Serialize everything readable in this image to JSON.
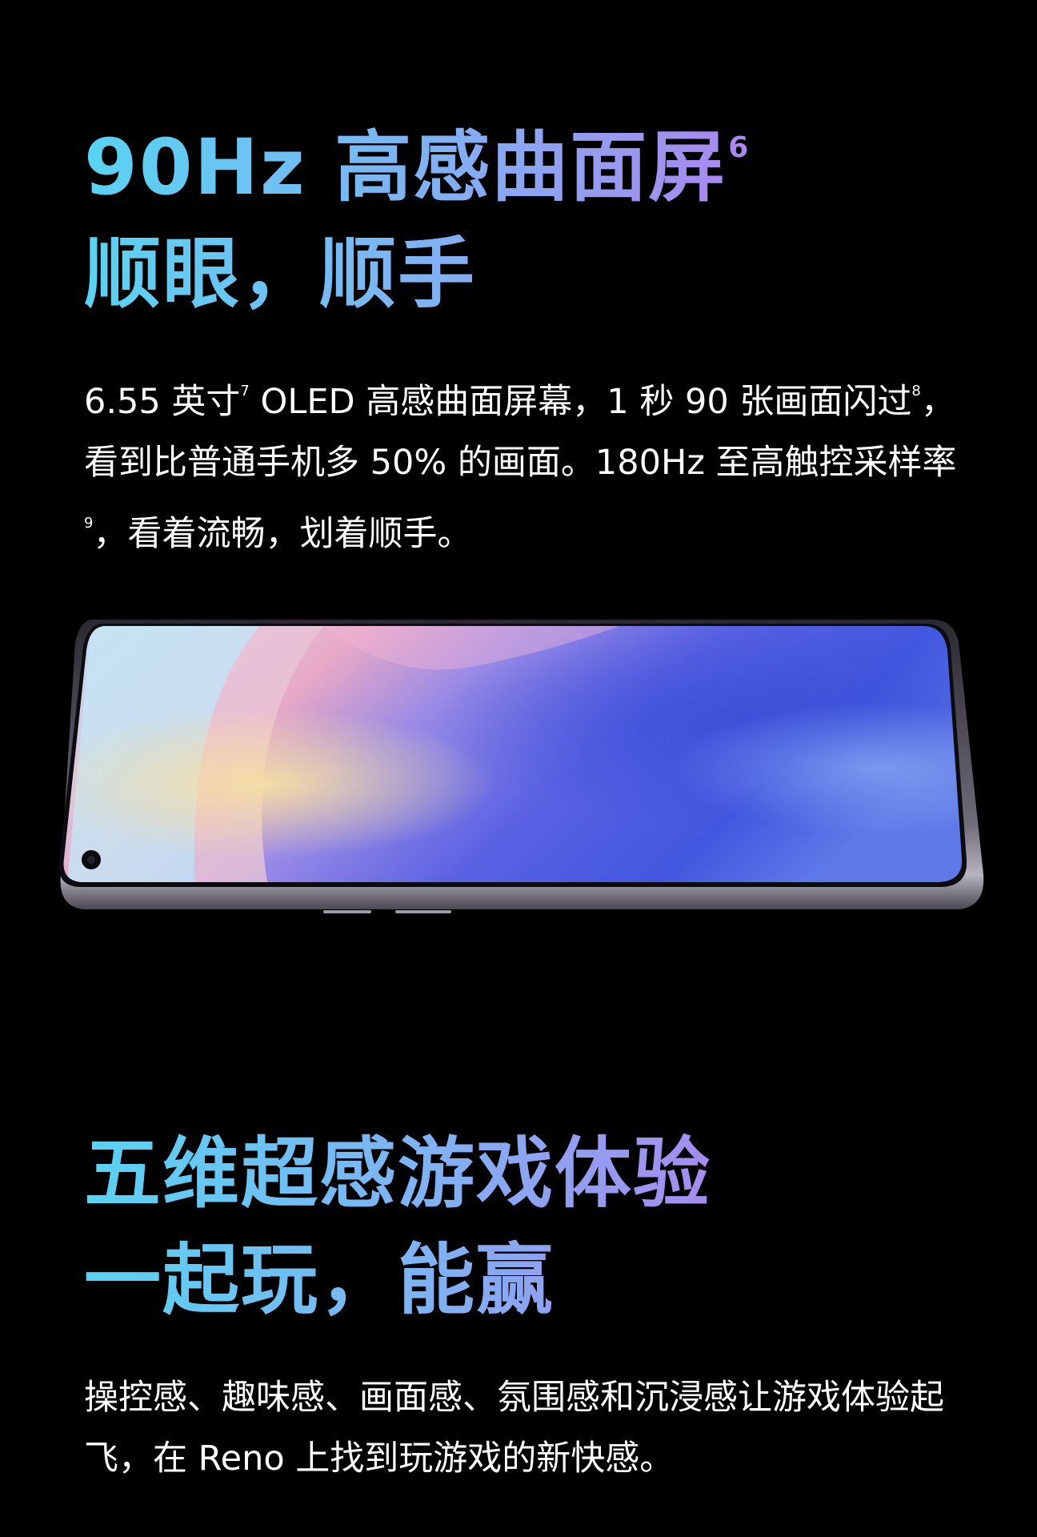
{
  "section1": {
    "title_line1": "90Hz 高感曲面屏",
    "title_line1_sup": "6",
    "title_line2": "顺眼，顺手",
    "body": [
      {
        "text": "6.55 英寸",
        "sup": "7"
      },
      {
        "text": " OLED 高感曲面屏幕，1 秒 90 张画面闪过",
        "sup": "8"
      },
      {
        "text": "，看到比普通手机多 50% 的画面。180Hz 至高触控采样率",
        "sup": "9"
      },
      {
        "text": "，看着流畅，划着顺手。",
        "sup": ""
      }
    ]
  },
  "phone_image": {
    "icon": "phone-curved-screen-illustration",
    "colors": {
      "screen_left": "#bfe3f4",
      "screen_pink": "#e7a3c8",
      "screen_yellow": "#f4d9a0",
      "screen_blue": "#4257e0",
      "frame": "#8f8a99"
    }
  },
  "section2": {
    "title_line1": "五维超感游戏体验",
    "title_line2": "一起玩，能赢",
    "body": "操控感、趣味感、画面感、氛围感和沉浸感让游戏体验起飞，在 Reno 上找到玩游戏的新快感。"
  },
  "colors": {
    "background": "#000000",
    "gradient_start": "#59d3f2",
    "gradient_end": "#c08be9",
    "body_text": "#ffffff"
  }
}
